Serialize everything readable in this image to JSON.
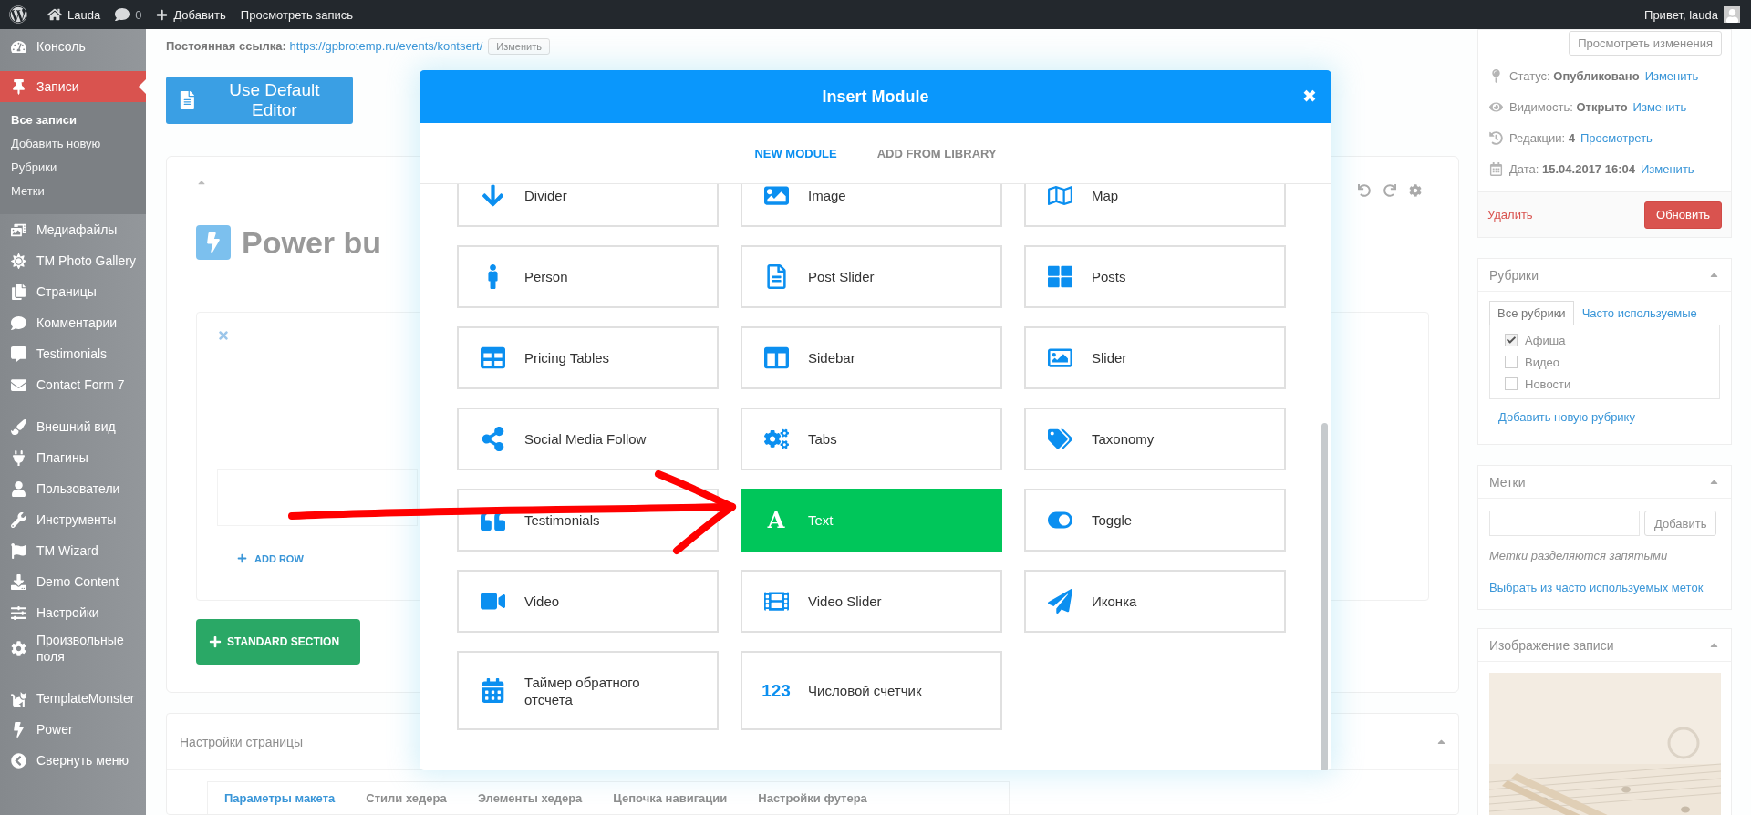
{
  "admin_bar": {
    "site": "Lauda",
    "comments": "0",
    "new": "Добавить",
    "view": "Просмотреть запись",
    "greeting": "Привет, lauda"
  },
  "sidebar": {
    "sections": [
      [
        {
          "label": "Консоль",
          "selected": false
        }
      ],
      [
        {
          "label": "Записи",
          "selected": true,
          "children": [
            {
              "label": "Все записи",
              "selected": true
            },
            {
              "label": "Добавить новую",
              "selected": false
            },
            {
              "label": "Рубрики",
              "selected": false
            },
            {
              "label": "Метки",
              "selected": false
            }
          ]
        },
        {
          "label": "Медиафайлы",
          "selected": false
        },
        {
          "label": "TM Photo Gallery",
          "selected": false
        },
        {
          "label": "Страницы",
          "selected": false
        },
        {
          "label": "Комментарии",
          "selected": false
        },
        {
          "label": "Testimonials",
          "selected": false
        },
        {
          "label": "Contact Form 7",
          "selected": false
        }
      ],
      [
        {
          "label": "Внешний вид",
          "selected": false
        },
        {
          "label": "Плагины",
          "selected": false
        },
        {
          "label": "Пользователи",
          "selected": false
        },
        {
          "label": "Инструменты",
          "selected": false
        },
        {
          "label": "TM Wizard",
          "selected": false
        },
        {
          "label": "Demo Content",
          "selected": false
        },
        {
          "label": "Настройки",
          "selected": false
        },
        {
          "label": "Произвольные поля",
          "selected": false
        }
      ],
      [
        {
          "label": "TemplateMonster",
          "selected": false
        },
        {
          "label": "Power",
          "selected": false
        },
        {
          "label": "Свернуть меню",
          "selected": false
        }
      ]
    ]
  },
  "editor": {
    "permalink_label": "Постоянная ссылка:",
    "permalink_url": "https://gpbrotemp.ru/events/kontsert/",
    "permalink_button": "Изменить",
    "default_editor_button": "Use Default Editor",
    "builder_title": "Power bu",
    "add_row": "ADD ROW",
    "standard_section": "STANDARD SECTION"
  },
  "page_settings": {
    "title": "Настройки страницы",
    "tabs": [
      {
        "label": "Параметры макета",
        "selected": true
      },
      {
        "label": "Стили хедера",
        "selected": false
      },
      {
        "label": "Элементы хедера",
        "selected": false
      },
      {
        "label": "Цепочка навигации",
        "selected": false
      },
      {
        "label": "Настройки футера",
        "selected": false
      }
    ]
  },
  "publish": {
    "preview_button": "Просмотреть изменения",
    "rows": [
      {
        "label": "Статус:",
        "value": "Опубликовано",
        "link": "Изменить"
      },
      {
        "label": "Видимость:",
        "value": "Открыто",
        "link": "Изменить"
      },
      {
        "label": "Редакции:",
        "value": "4",
        "link": "Просмотреть"
      },
      {
        "label": "Дата:",
        "value": "15.04.2017 16:04",
        "link": "Изменить"
      }
    ],
    "delete": "Удалить",
    "update": "Обновить"
  },
  "categories": {
    "title": "Рубрики",
    "tabs": [
      {
        "label": "Все рубрики",
        "selected": true
      },
      {
        "label": "Часто используемые",
        "selected": false
      }
    ],
    "items": [
      {
        "label": "Афиша",
        "checked": true
      },
      {
        "label": "Видео",
        "checked": false
      },
      {
        "label": "Новости",
        "checked": false
      }
    ],
    "add_link": "Добавить новую рубрику"
  },
  "tags": {
    "title": "Метки",
    "add_button": "Добавить",
    "hint": "Метки разделяются запятыми",
    "choose_link": "Выбрать из часто используемых меток"
  },
  "featured_image": {
    "title": "Изображение записи"
  },
  "modal": {
    "title": "Insert Module",
    "close": "✖",
    "tabs": [
      {
        "label": "NEW MODULE",
        "selected": true
      },
      {
        "label": "ADD FROM LIBRARY",
        "selected": false
      }
    ],
    "modules": [
      {
        "label": "Divider",
        "kind": "icon",
        "selected": false
      },
      {
        "label": "Image",
        "kind": "icon",
        "selected": false
      },
      {
        "label": "Map",
        "kind": "icon",
        "selected": false
      },
      {
        "label": "Person",
        "kind": "icon",
        "selected": false
      },
      {
        "label": "Post Slider",
        "kind": "icon",
        "selected": false
      },
      {
        "label": "Posts",
        "kind": "icon",
        "selected": false
      },
      {
        "label": "Pricing Tables",
        "kind": "icon",
        "selected": false
      },
      {
        "label": "Sidebar",
        "kind": "icon",
        "selected": false
      },
      {
        "label": "Slider",
        "kind": "icon",
        "selected": false
      },
      {
        "label": "Social Media Follow",
        "kind": "icon",
        "selected": false
      },
      {
        "label": "Tabs",
        "kind": "icon",
        "selected": false
      },
      {
        "label": "Taxonomy",
        "kind": "icon",
        "selected": false
      },
      {
        "label": "Testimonials",
        "kind": "icon",
        "selected": false
      },
      {
        "label": "Text",
        "kind": "glyph",
        "glyph": "A",
        "selected": true
      },
      {
        "label": "Toggle",
        "kind": "icon",
        "selected": false
      },
      {
        "label": "Video",
        "kind": "icon",
        "selected": false
      },
      {
        "label": "Video Slider",
        "kind": "icon",
        "selected": false
      },
      {
        "label": "Иконка",
        "kind": "icon",
        "selected": false
      },
      {
        "label": "Таймер обратного отсчета",
        "kind": "icon",
        "selected": false
      },
      {
        "label": "Числовой счетчик",
        "kind": "glyph",
        "glyph": "123",
        "selected": false
      }
    ]
  }
}
